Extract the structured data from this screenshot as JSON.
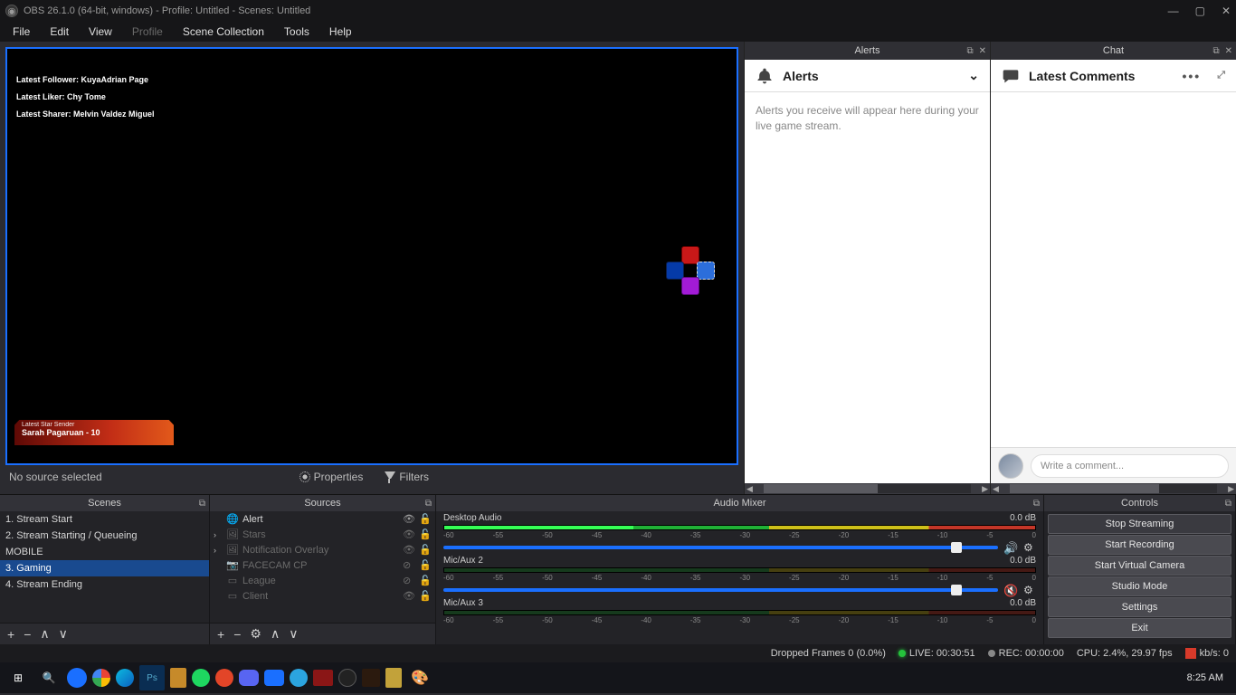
{
  "title": "OBS 26.1.0 (64-bit, windows) - Profile: Untitled - Scenes: Untitled",
  "menu": [
    "File",
    "Edit",
    "View",
    "Profile",
    "Scene Collection",
    "Tools",
    "Help"
  ],
  "menu_disabled_index": 3,
  "preview": {
    "banners": [
      "Latest Follower: KuyaAdrian Page",
      "Latest Liker: Chy Tome",
      "Latest Sharer: Melvin Valdez Miguel"
    ],
    "star_sender_label": "Latest Star Sender",
    "star_sender_value": "Sarah Pagaruan - 10"
  },
  "toolbar": {
    "no_source": "No source selected",
    "properties": "Properties",
    "filters": "Filters"
  },
  "alerts": {
    "dock_title": "Alerts",
    "panel_title": "Alerts",
    "body": "Alerts you receive will appear here during your live game stream."
  },
  "chat": {
    "dock_title": "Chat",
    "panel_title": "Latest Comments",
    "placeholder": "Write a comment..."
  },
  "scenes": {
    "title": "Scenes",
    "items": [
      "1. Stream Start",
      "2. Stream Starting / Queueing",
      "MOBILE",
      "3. Gaming",
      "4. Stream Ending"
    ],
    "selected_index": 3
  },
  "sources": {
    "title": "Sources",
    "items": [
      {
        "icon": "globe",
        "name": "Alert",
        "expandable": false,
        "visible": true,
        "locked": false,
        "dim": false
      },
      {
        "icon": "img",
        "name": "Stars",
        "expandable": true,
        "visible": true,
        "locked": false,
        "dim": true
      },
      {
        "icon": "img",
        "name": "Notification Overlay",
        "expandable": true,
        "visible": true,
        "locked": false,
        "dim": true
      },
      {
        "icon": "cam",
        "name": "FACECAM CP",
        "expandable": false,
        "visible": false,
        "locked": false,
        "dim": true
      },
      {
        "icon": "win",
        "name": "League",
        "expandable": false,
        "visible": false,
        "locked": false,
        "dim": true
      },
      {
        "icon": "win",
        "name": "Client",
        "expandable": false,
        "visible": true,
        "locked": false,
        "dim": true
      }
    ]
  },
  "mixer": {
    "title": "Audio Mixer",
    "ticks": [
      "-60",
      "-55",
      "-50",
      "-45",
      "-40",
      "-35",
      "-30",
      "-25",
      "-20",
      "-15",
      "-10",
      "-5",
      "0"
    ],
    "channels": [
      {
        "name": "Desktop Audio",
        "db": "0.0 dB",
        "muted": false,
        "level": 32
      },
      {
        "name": "Mic/Aux 2",
        "db": "0.0 dB",
        "muted": true,
        "level": 0
      },
      {
        "name": "Mic/Aux 3",
        "db": "0.0 dB",
        "muted": false,
        "level": 0
      }
    ]
  },
  "controls": {
    "title": "Controls",
    "buttons": [
      "Stop Streaming",
      "Start Recording",
      "Start Virtual Camera",
      "Studio Mode",
      "Settings",
      "Exit"
    ]
  },
  "status": {
    "dropped": "Dropped Frames 0 (0.0%)",
    "live": "LIVE: 00:30:51",
    "rec": "REC: 00:00:00",
    "cpu": "CPU: 2.4%, 29.97 fps",
    "kbps": "kb/s: 0"
  },
  "clock": "8:25 AM"
}
